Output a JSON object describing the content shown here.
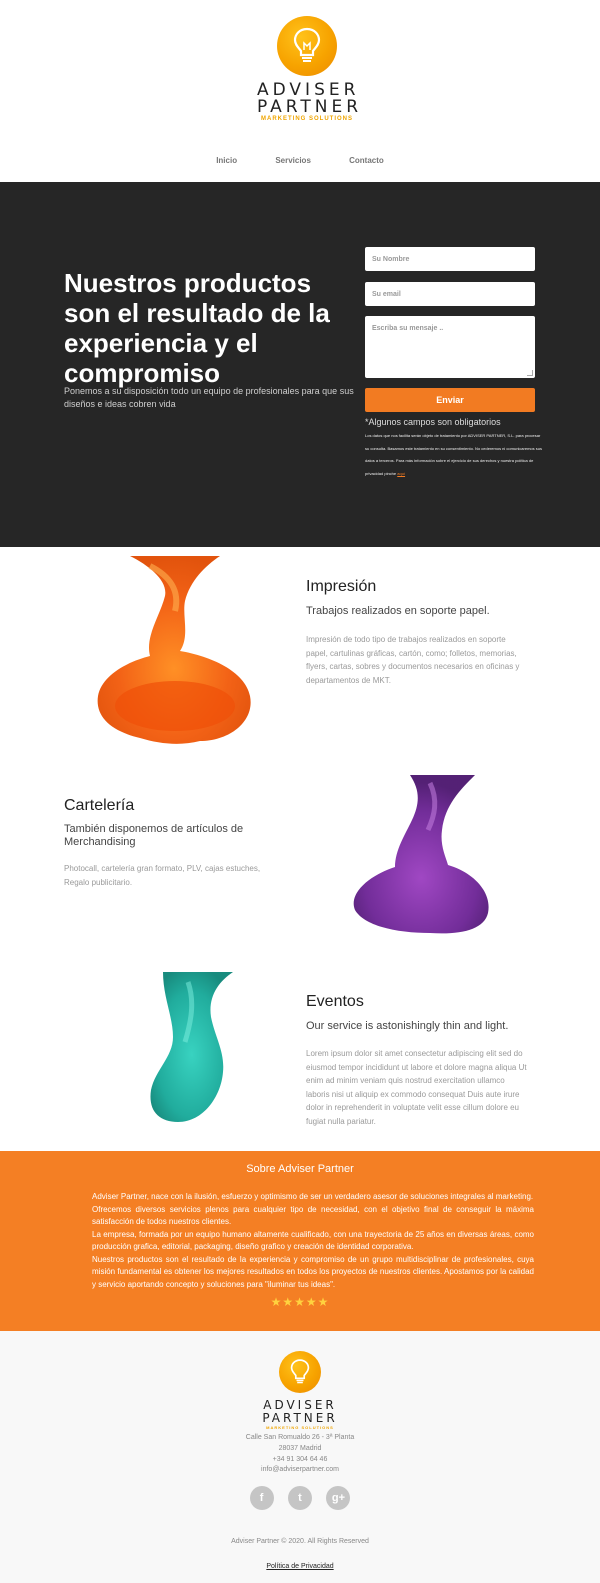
{
  "brand": {
    "line1": "ADVISER",
    "line2": "PARTNER",
    "tagline": "MARKETING SOLUTIONS"
  },
  "nav": [
    "Inicio",
    "Servicios",
    "Contacto"
  ],
  "hero": {
    "title": "Nuestros productos son el resultado de la experiencia y el compromiso",
    "subtitle": "Ponemos a su disposición todo un equipo de profesionales para que sus diseños e ideas cobren vida"
  },
  "form": {
    "name_placeholder": "Su Nombre",
    "email_placeholder": "Su email",
    "message_placeholder": "Escriba su mensaje ..",
    "send_label": "Enviar",
    "required_note": "*Algunos campos son obligatorios",
    "legal_text": "Los datos que nos facilita serán objeto de tratamiento por ADVISER PARTNER, S.L. para procesar su consulta. Basamos este tratamiento en su consentimiento. No cederemos ni comunicaremos sus datos a terceros. Para más información sobre el ejercicio de sus derechos y nuestra política de privacidad pinche",
    "legal_link": "aquí"
  },
  "features": [
    {
      "title": "Impresión",
      "subtitle": "Trabajos realizados en soporte papel.",
      "description": "Impresión de todo tipo de trabajos realizados en soporte papel, cartulinas gráficas, cartón, como; folletos, memorias, flyers, cartas, sobres y documentos necesarios en oficinas y departamentos de MKT.",
      "color": "#f26a10"
    },
    {
      "title": "Cartelería",
      "subtitle": "También disponemos de artículos de Merchandising",
      "description": "Photocall, cartelería gran formato, PLV, cajas estuches, Regalo publicitario.",
      "color": "#7a2c9e"
    },
    {
      "title": "Eventos",
      "subtitle": "Our service is astonishingly thin and light.",
      "description": "Lorem ipsum dolor sit amet consectetur adipiscing elit sed do eiusmod tempor incididunt ut labore et dolore magna aliqua Ut enim ad minim veniam quis nostrud exercitation ullamco laboris nisi ut aliquip ex commodo consequat Duis aute irure dolor in reprehenderit in voluptate velit esse cillum dolore eu fugiat nulla pariatur.",
      "color": "#17b3a3"
    }
  ],
  "about": {
    "title": "Sobre Adviser Partner",
    "p1": "Adviser Partner, nace con la ilusión, esfuerzo y optimismo de ser un verdadero asesor de soluciones integrales al marketing.",
    "p2": "Ofrecemos diversos servicios plenos para cualquier tipo de necesidad, con el objetivo final de conseguir la máxima satisfacción de todos nuestros clientes.",
    "p3": "La empresa, formada por un equipo humano altamente cualificado, con una trayectoria de 25 años en diversas áreas, como producción grafica, editorial, packaging, diseño grafico y creación de identidad corporativa.",
    "p4": "Nuestros productos son el resultado de la experiencia y compromiso de un grupo multidisciplinar de profesionales, cuya misión fundamental es obtener los mejores resultados en todos los proyectos de nuestros clientes. Apostamos por la calidad y servicio aportando concepto y soluciones para \"iluminar tus ideas\".",
    "stars": "★★★★★",
    "rating": 5
  },
  "footer": {
    "address1": "Calle San Romualdo 26 - 3ª Planta",
    "address2": "28037 Madrid",
    "phone": "+34 91 304 64 46",
    "email": "info@adviserpartner.com",
    "social": [
      {
        "icon": "facebook-icon",
        "glyph": "f"
      },
      {
        "icon": "twitter-icon",
        "glyph": "t"
      },
      {
        "icon": "google-plus-icon",
        "glyph": "g+"
      }
    ],
    "copyright": "Adviser Partner © 2020. All Rights Reserved",
    "policy": "Política de Privacidad"
  },
  "colors": {
    "accent": "#f47f24",
    "hero_bg": "#262626",
    "logo_yellow": "#f7a300"
  }
}
